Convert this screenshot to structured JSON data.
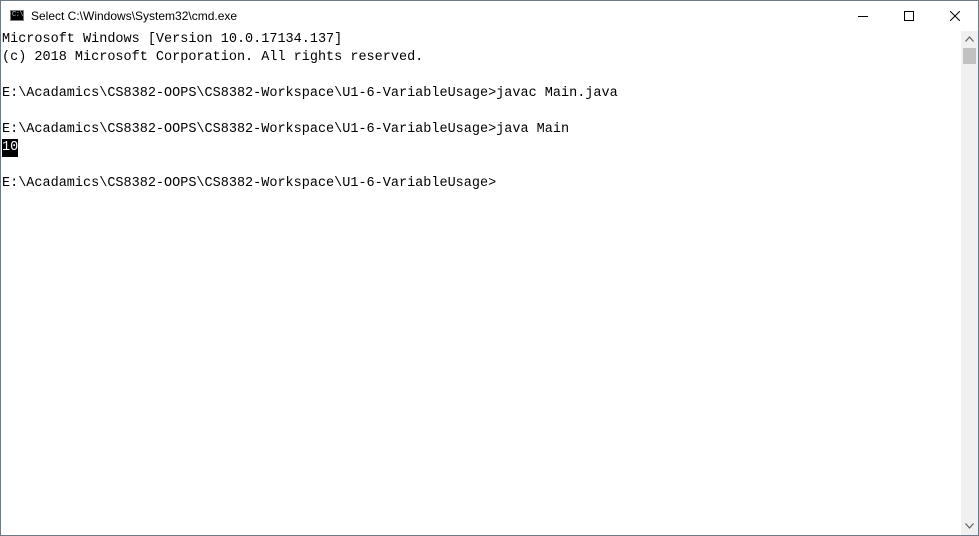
{
  "window": {
    "title": "Select C:\\Windows\\System32\\cmd.exe",
    "icon": "cmd-icon",
    "icon_glyph": "C:\\",
    "controls": [
      "minimize-icon",
      "maximize-icon",
      "close-icon"
    ]
  },
  "console": {
    "lines": [
      "Microsoft Windows [Version 10.0.17134.137]",
      "(c) 2018 Microsoft Corporation. All rights reserved.",
      "",
      "E:\\Acadamics\\CS8382-OOPS\\CS8382-Workspace\\U1-6-VariableUsage>javac Main.java",
      "",
      "E:\\Acadamics\\CS8382-OOPS\\CS8382-Workspace\\U1-6-VariableUsage>java Main",
      "10",
      "",
      "E:\\Acadamics\\CS8382-OOPS\\CS8382-Workspace\\U1-6-VariableUsage>"
    ],
    "selected_line_index": 6,
    "background": "#ffffff",
    "text_color": "#000000"
  },
  "scrollbar": {
    "up_icon": "chevron-up-icon",
    "down_icon": "chevron-down-icon"
  }
}
